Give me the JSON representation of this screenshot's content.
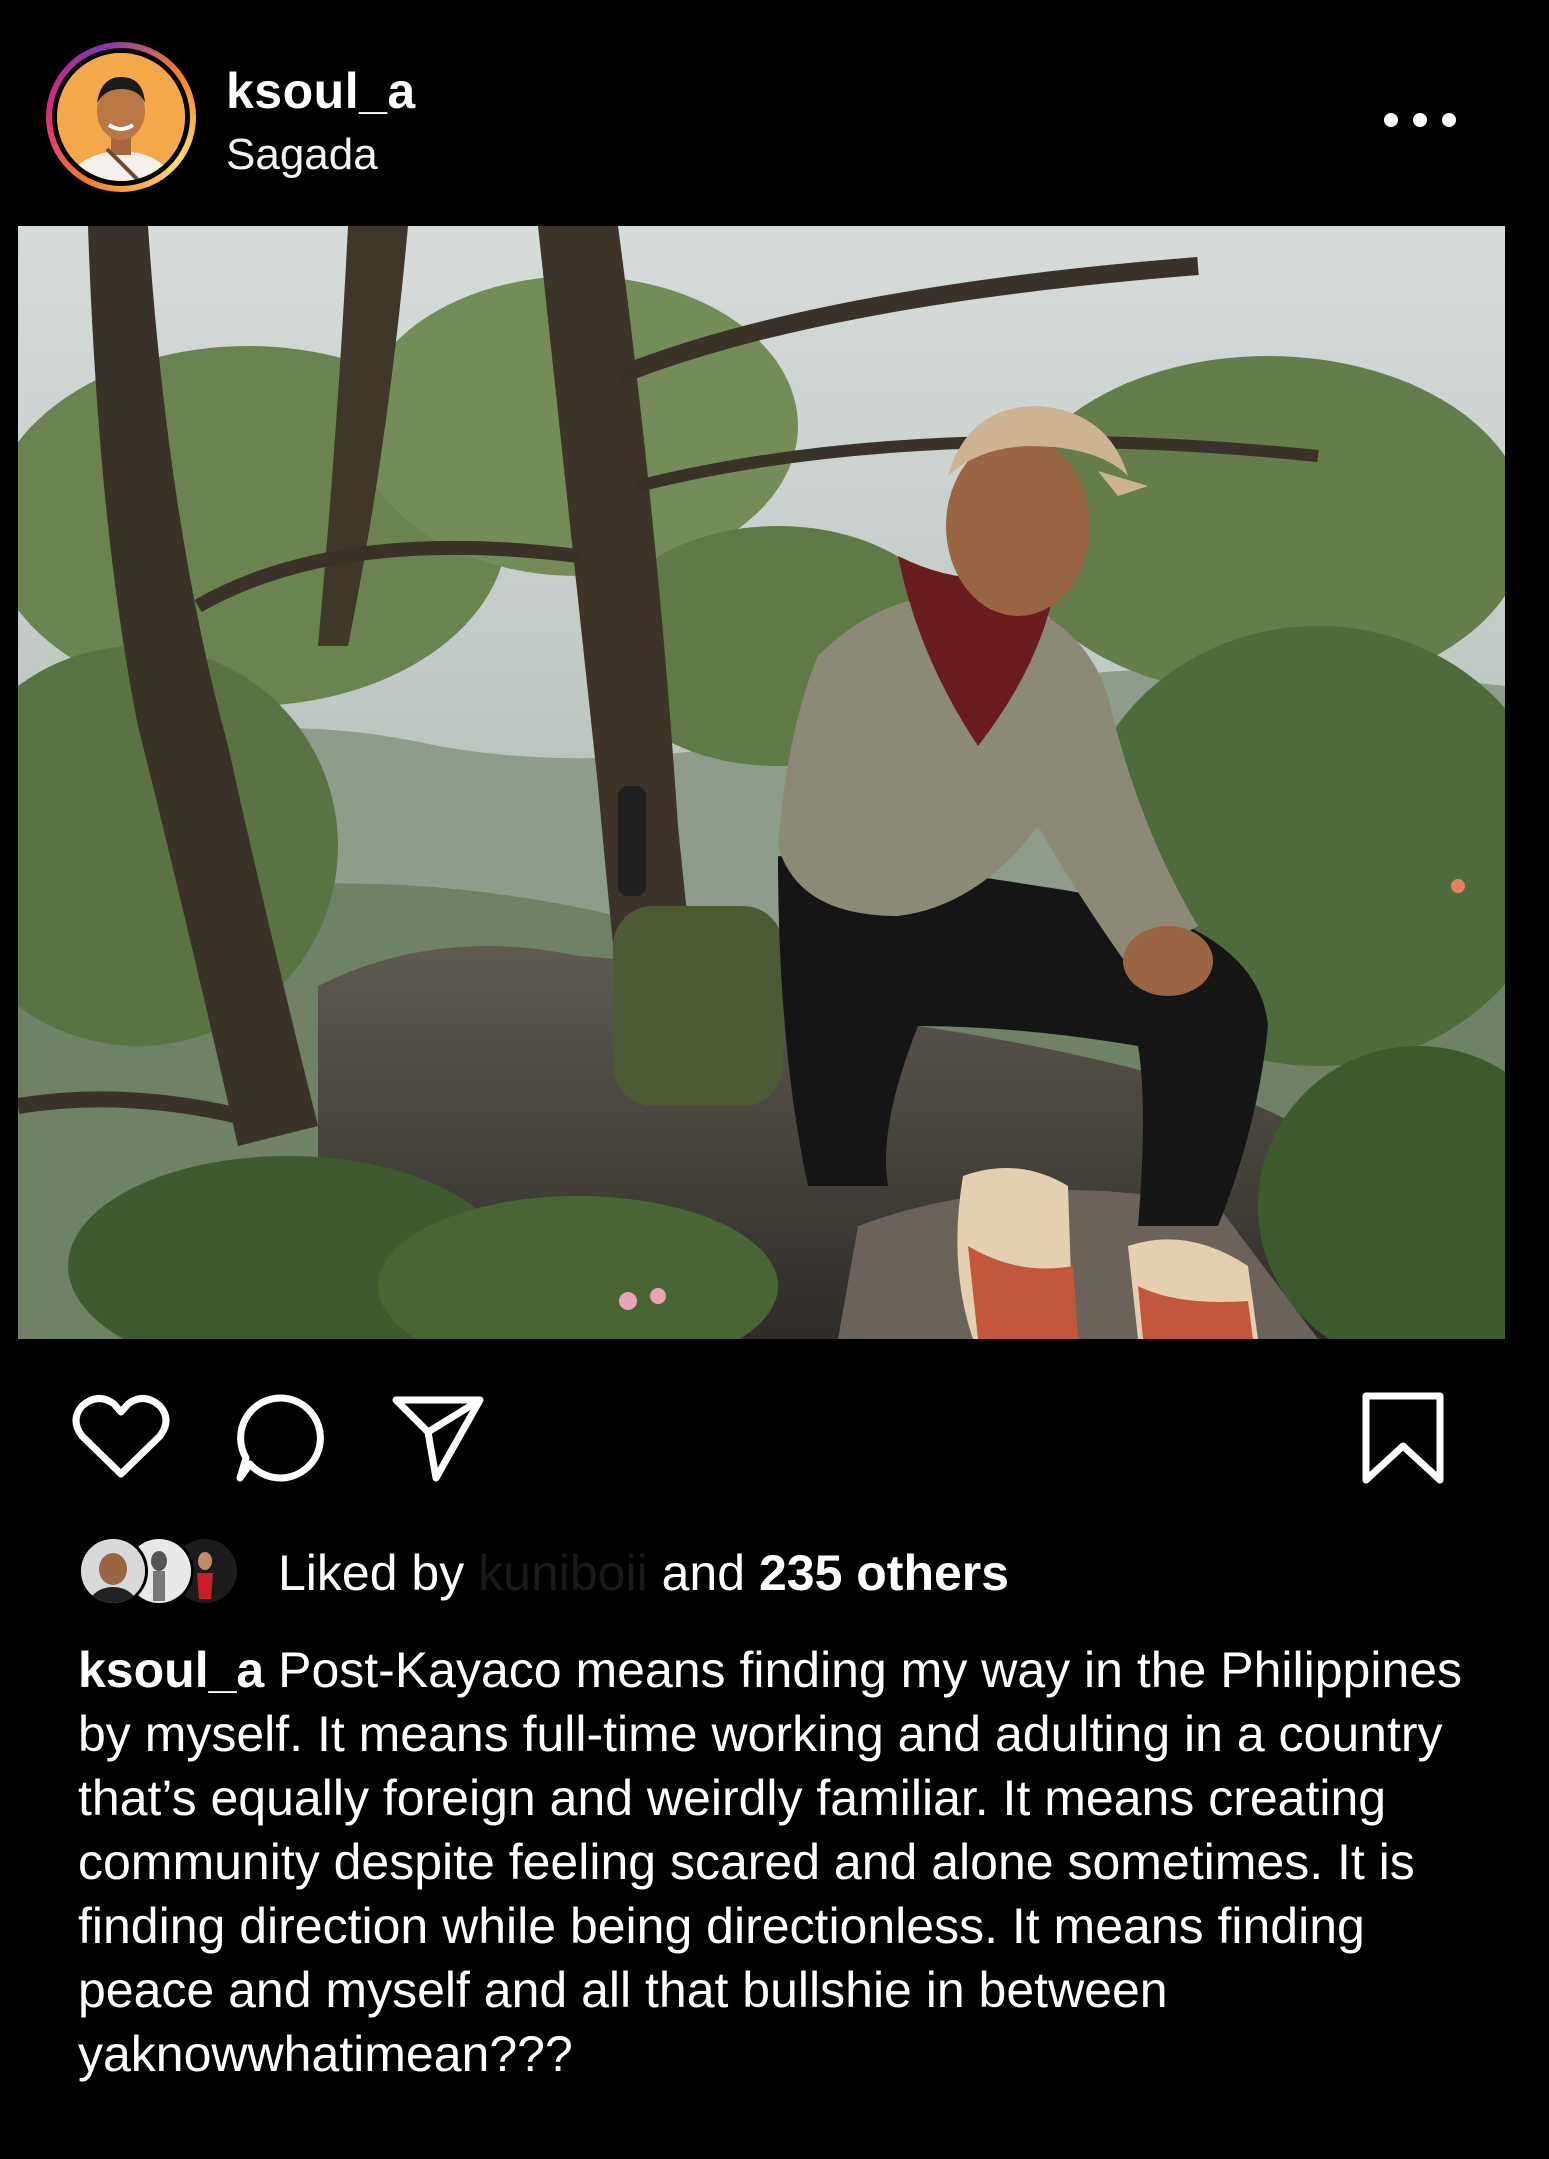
{
  "post": {
    "username": "ksoul_a",
    "location": "Sagada",
    "more_icon": "more-horizontal-icon"
  },
  "actions": {
    "like_icon": "heart-icon",
    "comment_icon": "comment-icon",
    "share_icon": "send-icon",
    "save_icon": "bookmark-icon"
  },
  "likes": {
    "prefix": "Liked by",
    "liker": "kuniboii",
    "connector": "and",
    "count_text": "235 others"
  },
  "caption": {
    "username": "ksoul_a",
    "text": "Post-Kayaco means finding my way in the Philippines by myself. It means full-time working and adulting in a country that’s equally foreign and weirdly familiar. It means creating community despite feeling scared and alone sometimes. It is finding direction while being directionless. It means finding peace and myself and all that bullshie in between yaknowwhatimean???"
  }
}
